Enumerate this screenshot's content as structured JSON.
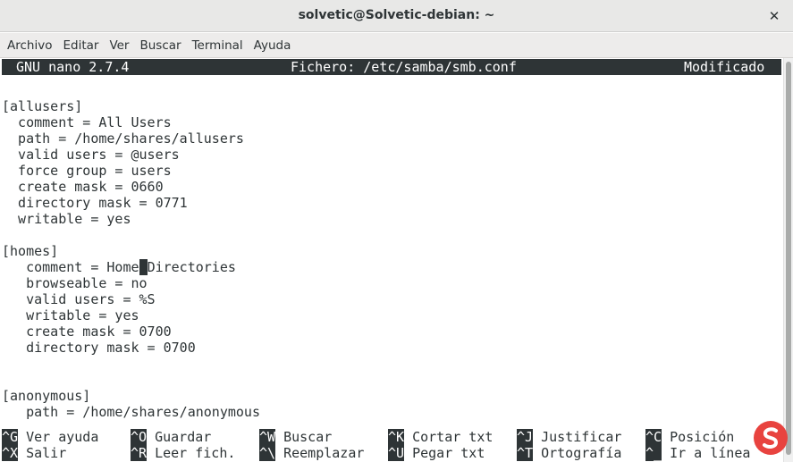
{
  "window": {
    "title": "solvetic@Solvetic-debian: ~",
    "close_glyph": "✕"
  },
  "menu": [
    "Archivo",
    "Editar",
    "Ver",
    "Buscar",
    "Terminal",
    "Ayuda"
  ],
  "nano_header": {
    "version": "GNU nano 2.7.4",
    "file": "Fichero: /etc/samba/smb.conf",
    "status": "Modificado"
  },
  "file_lines": [
    "",
    "[allusers]",
    "  comment = All Users",
    "  path = /home/shares/allusers",
    "  valid users = @users",
    "  force group = users",
    "  create mask = 0660",
    "  directory mask = 0771",
    "  writable = yes",
    "",
    "[homes]",
    "   comment = Home Directories",
    "   browseable = no",
    "   valid users = %S",
    "   writable = yes",
    "   create mask = 0700",
    "   directory mask = 0700",
    "",
    "",
    "[anonymous]",
    "   path = /home/shares/anonymous"
  ],
  "cursor": {
    "before": "   comment = Home",
    "char": " ",
    "after": "Directories"
  },
  "shortcuts_row1": [
    {
      "key": "^G",
      "desc": " Ver ayuda"
    },
    {
      "key": "^O",
      "desc": " Guardar"
    },
    {
      "key": "^W",
      "desc": " Buscar"
    },
    {
      "key": "^K",
      "desc": " Cortar txt"
    },
    {
      "key": "^J",
      "desc": " Justificar"
    },
    {
      "key": "^C",
      "desc": " Posición"
    }
  ],
  "shortcuts_row2": [
    {
      "key": "^X",
      "desc": " Salir"
    },
    {
      "key": "^R",
      "desc": " Leer fich."
    },
    {
      "key": "^\\",
      "desc": " Reemplazar"
    },
    {
      "key": "^U",
      "desc": " Pegar txt"
    },
    {
      "key": "^T",
      "desc": " Ortografía"
    },
    {
      "key": "^_",
      "desc": " Ir a línea"
    }
  ],
  "colors": {
    "terminal_fg": "#2e3436",
    "terminal_bg": "#ffffff",
    "logo_red": "#e8433f"
  },
  "logo_icon": "solvetic-logo-icon"
}
